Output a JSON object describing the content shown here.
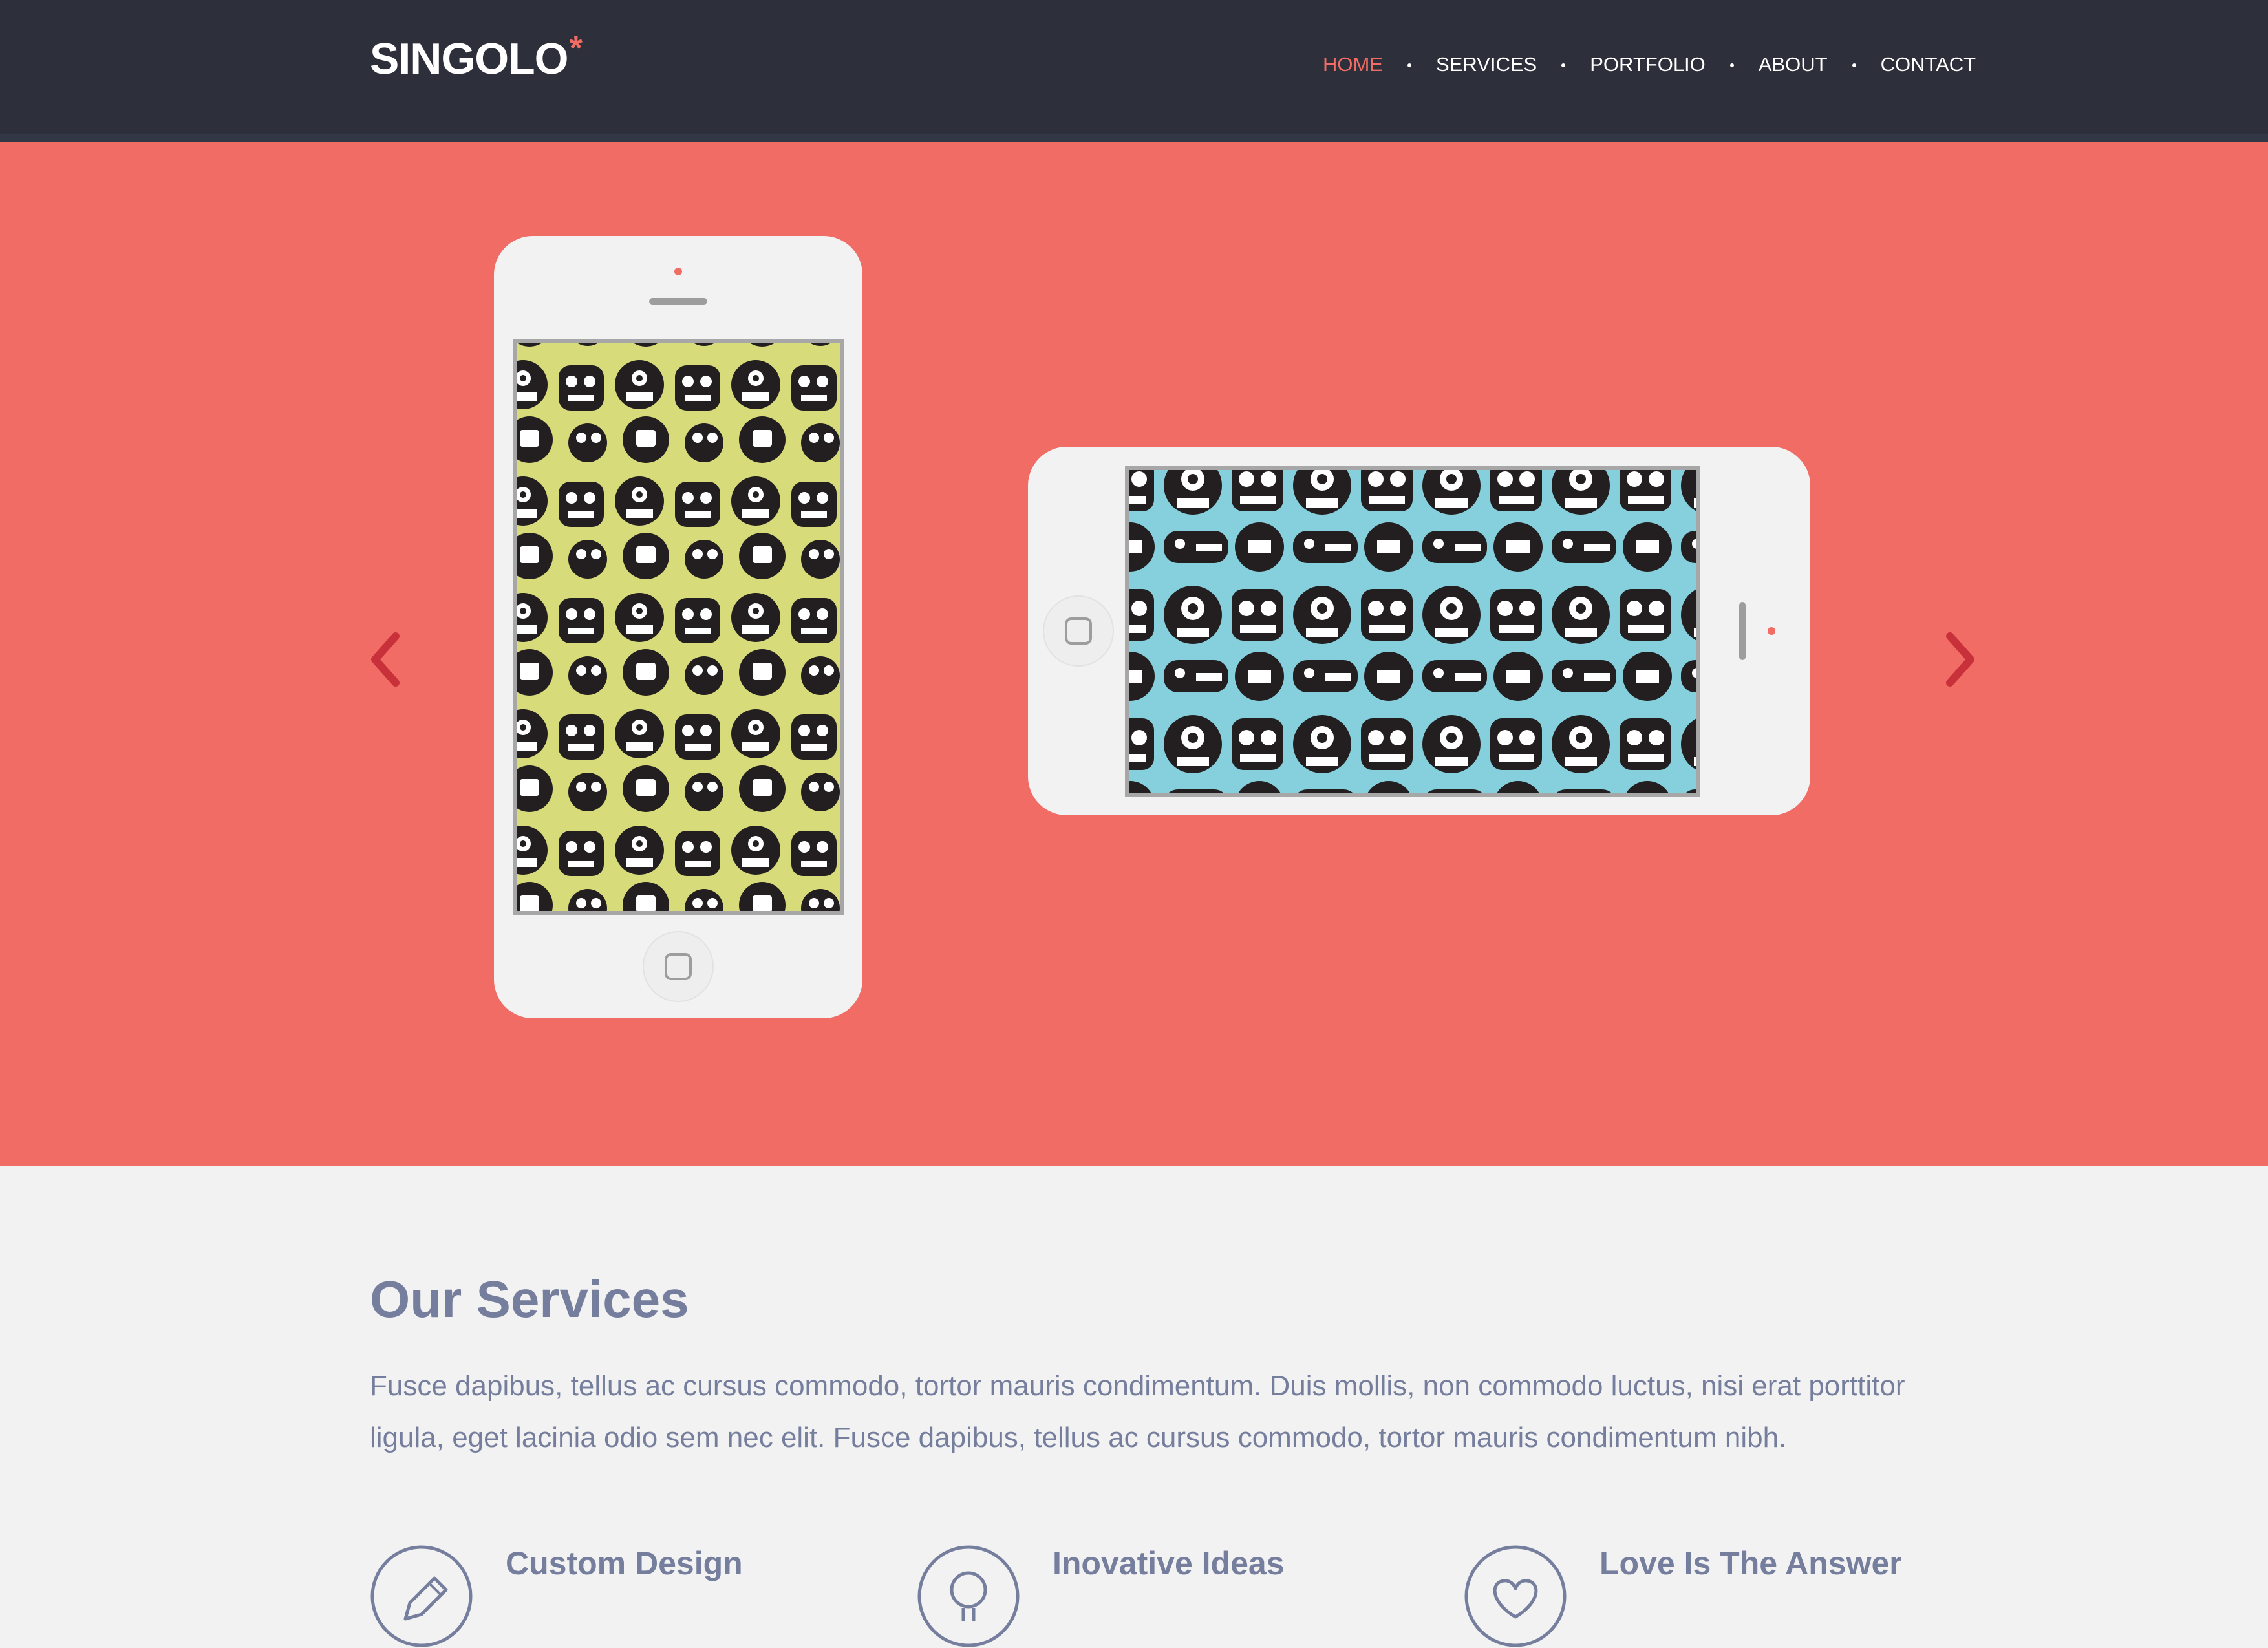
{
  "header": {
    "logo": "SINGOLO",
    "logo_mark": "*",
    "nav": [
      {
        "label": "HOME",
        "active": true
      },
      {
        "label": "SERVICES",
        "active": false
      },
      {
        "label": "PORTFOLIO",
        "active": false
      },
      {
        "label": "ABOUT",
        "active": false
      },
      {
        "label": "CONTACT",
        "active": false
      }
    ]
  },
  "slider": {
    "prev_icon": "chevron-left-icon",
    "next_icon": "chevron-right-icon",
    "phone_vertical_screen_color": "#d8db7a",
    "phone_horizontal_screen_color": "#86cfdc"
  },
  "services": {
    "title": "Our Services",
    "description": "Fusce dapibus, tellus ac cursus commodo, tortor mauris condimentum. Duis mollis, non commodo luctus, nisi erat porttitor ligula, eget lacinia odio sem nec elit. Fusce dapibus, tellus ac cursus commodo, tortor mauris condimentum nibh.",
    "items": [
      {
        "title": "Custom Design",
        "icon": "pencil-icon"
      },
      {
        "title": "Inovative Ideas",
        "icon": "lightbulb-icon"
      },
      {
        "title": "Love Is The Answer",
        "icon": "heart-icon"
      }
    ]
  },
  "colors": {
    "header_bg": "#2d303a",
    "accent": "#f06c64",
    "hero_bg": "#f06c65",
    "text_muted": "#767e9e"
  }
}
